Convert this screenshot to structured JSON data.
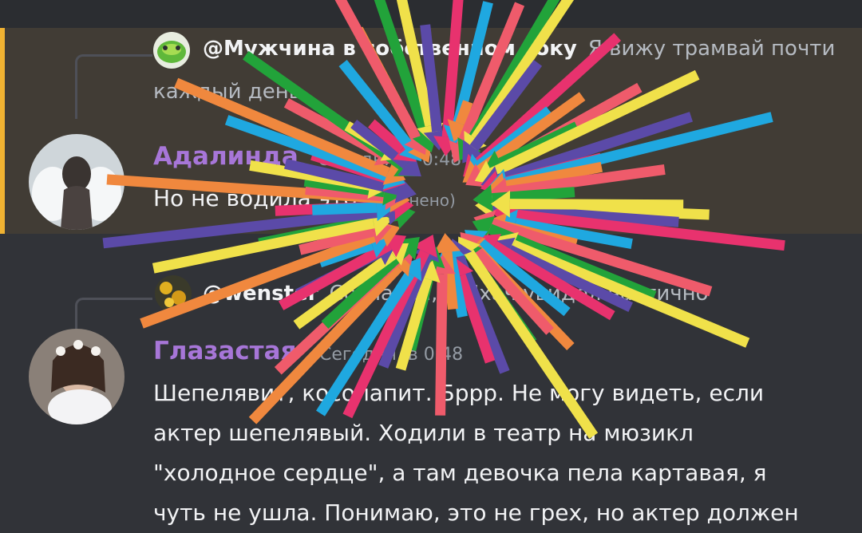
{
  "colors": {
    "background": "#313338",
    "highlight": "#413c35",
    "highlight_bar": "#f0b232",
    "author": "#a776d8",
    "text": "#f2f3f5",
    "muted": "#949ba4"
  },
  "messages": [
    {
      "reply": {
        "mention": "@Мужчина в собственном соку",
        "text": "Я вижу трамвай почти",
        "continuation": "каждый день"
      },
      "author": "Адалинда",
      "timestamp": "Сегодня, в 0:48",
      "content": "Но не водила это",
      "edited": "(изменено)"
    },
    {
      "reply": {
        "mention": "@wenster",
        "text": "Согласен, а Ихач увидел частично"
      },
      "author": "Глазастая",
      "timestamp": "Сегодня, в 0:48",
      "content_lines": [
        "Шепелявит, косолапит. Бррр.  Не могу видеть, если",
        "актер шепелявый. Ходили в театр на мюзикл",
        "\"холодное сердце\", а там девочка пела картавая, я",
        "чуть не ушла. Понимаю, это не грех, но актер должен"
      ]
    }
  ],
  "overlay": {
    "description_icon": "arrow-burst-overlay",
    "arrow_colors": [
      "#f0e14a",
      "#5b4aa8",
      "#e8326e",
      "#1fa8e0",
      "#f0883e",
      "#ef5b6b",
      "#22a33a"
    ]
  }
}
